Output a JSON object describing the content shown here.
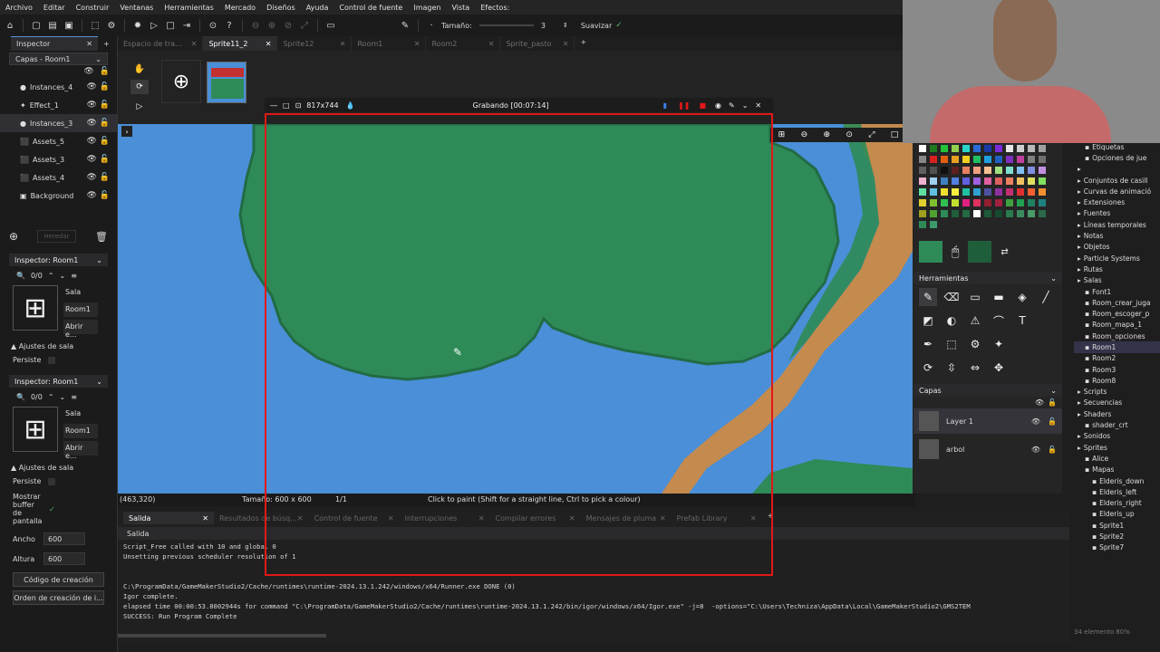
{
  "menubar": [
    "Archivo",
    "Editar",
    "Construir",
    "Ventanas",
    "Herramientas",
    "Mercado",
    "Diseños",
    "Ayuda",
    "Control de fuente",
    "Imagen",
    "Vista",
    "Efectos:"
  ],
  "toolbar": {
    "size_label": "Tamaño:",
    "size_value": "3",
    "smooth_label": "Suavizar"
  },
  "tabs": [
    {
      "label": "Espacio de tra...",
      "active": false
    },
    {
      "label": "Sprite11_2",
      "active": true
    },
    {
      "label": "Sprite12",
      "active": false
    },
    {
      "label": "Room1",
      "active": false
    },
    {
      "label": "Room2",
      "active": false
    },
    {
      "label": "Sprite_pasto",
      "active": false
    }
  ],
  "left": {
    "inspector_tab": "Inspector",
    "layers_select": "Capas - Room1",
    "layers": [
      {
        "name": "Instances_4",
        "icon": "instances-icon",
        "selected": false
      },
      {
        "name": "Effect_1",
        "icon": "effect-icon",
        "selected": false
      },
      {
        "name": "Instances_3",
        "icon": "instances-icon",
        "selected": true
      },
      {
        "name": "Assets_5",
        "icon": "assets-icon",
        "selected": false
      },
      {
        "name": "Assets_3",
        "icon": "assets-icon",
        "selected": false
      },
      {
        "name": "Assets_4",
        "icon": "assets-icon",
        "selected": false
      },
      {
        "name": "Background",
        "icon": "background-icon",
        "selected": false
      }
    ],
    "inherit_label": "Heredar",
    "inspector1": {
      "title": "Inspector: Room1",
      "count": "0/0",
      "sala": "Sala",
      "room": "Room1",
      "open": "Abrir e...",
      "settings": "Ajustes de sala",
      "persist": "Persiste"
    },
    "inspector2": {
      "title": "Inspector: Room1",
      "count": "0/0",
      "sala": "Sala",
      "room": "Room1",
      "open": "Abrir e...",
      "settings": "Ajustes de sala",
      "persist": "Persiste",
      "show_buffer": "Mostrar buffer de pantalla",
      "width_label": "Ancho",
      "width": "600",
      "height_label": "Altura",
      "height": "600",
      "code_btn": "Código de creación",
      "order_btn": "Orden de creación de i..."
    }
  },
  "recorder": {
    "size": "817x744",
    "status": "Grabando [00:07:14]"
  },
  "status": {
    "coords": "(463,320)",
    "size": "Tamaño: 600 x 600",
    "frame": "1/1",
    "hint": "Click to paint (Shift for a straight line, Ctrl to pick a colour)"
  },
  "output": {
    "tabs": [
      "Salida",
      "Resultados de búsq...",
      "Control de fuente",
      "Interrupciones",
      "Compilar errores",
      "Mensajes de pluma",
      "Prefab Library"
    ],
    "header": "Salida",
    "lines": [
      "Script_Free called with 10 and global 0",
      "Unsetting previous scheduler resolution of 1",
      "",
      "",
      "C:\\ProgramData/GameMakerStudio2/Cache/runtimes\\runtime-2024.13.1.242/windows/x64/Runner.exe DONE (0)",
      "Igor complete.",
      "elapsed time 00:00:53.8002944s for command \"C:\\ProgramData/GameMakerStudio2/Cache/runtimes\\runtime-2024.13.1.242/bin/igor/windows/x64/Igor.exe\" -j=8  -options=\"C:\\Users\\Techniza\\AppData\\Local\\GameMakerStudio2\\GMS2TEM",
      "SUCCESS: Run Program Complete"
    ]
  },
  "right": {
    "tools_label": "Herramientas",
    "layers_label": "Capas",
    "layer1": "Layer 1",
    "layer2": "arbol",
    "palette": [
      "#ffffff",
      "#1e7a1e",
      "#22c33a",
      "#8fd14f",
      "#2bd4c9",
      "#2a6cd6",
      "#1a3aa8",
      "#7b2cd6",
      "#e8e8e8",
      "#d0d0d0",
      "#b8b8b8",
      "#a0a0a0",
      "#888888",
      "#d92020",
      "#e06010",
      "#e8a020",
      "#f0d020",
      "#20c060",
      "#20a0e0",
      "#2060c0",
      "#8030c0",
      "#c040a0",
      "#808080",
      "#707070",
      "#606060",
      "#505050",
      "#101010",
      "#602020",
      "#e88060",
      "#f0a080",
      "#f8c090",
      "#a0e080",
      "#80e0d0",
      "#80c0f0",
      "#8090e0",
      "#c090e0",
      "#f0b0d0",
      "#a0d0f0",
      "#4080c0",
      "#5080e0",
      "#6060e0",
      "#a060e0",
      "#e060a0",
      "#e06060",
      "#f08060",
      "#f0c060",
      "#e0e060",
      "#80e060",
      "#60e0a0",
      "#60c0e0",
      "#f0e030",
      "#f8f040",
      "#20c0a0",
      "#30a0d0",
      "#5050a0",
      "#9030a0",
      "#c03070",
      "#e03030",
      "#f06030",
      "#f09030",
      "#e0d030",
      "#80c030",
      "#30c050",
      "#c0e030",
      "#e02080",
      "#e03060",
      "#902030",
      "#a02040",
      "#40a040",
      "#20a050",
      "#208060",
      "#208080",
      "#a0a020",
      "#50a030",
      "#2e8b57",
      "#1f5e3a",
      "#226b44",
      "#ffffff",
      "#1a5a38",
      "#164a2e",
      "#2a7a4e",
      "#3a8a5e",
      "#4a9a6a",
      "#2a6a4a",
      "#2e8b57",
      "#3a9a6a"
    ],
    "primary_color": "#2e8b57",
    "secondary_color": "#1f5e3a"
  },
  "tree": [
    {
      "label": "Etiquetas",
      "indent": 1
    },
    {
      "label": "Opciones de jue",
      "indent": 1
    },
    {
      "label": "",
      "indent": 0
    },
    {
      "label": "Conjuntos de casill",
      "indent": 0
    },
    {
      "label": "Curvas de animació",
      "indent": 0
    },
    {
      "label": "Extensiones",
      "indent": 0
    },
    {
      "label": "Fuentes",
      "indent": 0
    },
    {
      "label": "Líneas temporales",
      "indent": 0
    },
    {
      "label": "Notas",
      "indent": 0
    },
    {
      "label": "Objetos",
      "indent": 0
    },
    {
      "label": "Particle Systems",
      "indent": 0
    },
    {
      "label": "Rutas",
      "indent": 0
    },
    {
      "label": "Salas",
      "indent": 0
    },
    {
      "label": "Font1",
      "indent": 1
    },
    {
      "label": "Room_crear_juga",
      "indent": 1
    },
    {
      "label": "Room_escoger_p",
      "indent": 1
    },
    {
      "label": "Room_mapa_1",
      "indent": 1
    },
    {
      "label": "Room_opciones",
      "indent": 1
    },
    {
      "label": "Room1",
      "indent": 1,
      "selected": true
    },
    {
      "label": "Room2",
      "indent": 1
    },
    {
      "label": "Room3",
      "indent": 1
    },
    {
      "label": "Room8",
      "indent": 1
    },
    {
      "label": "Scripts",
      "indent": 0
    },
    {
      "label": "Secuencias",
      "indent": 0
    },
    {
      "label": "Shaders",
      "indent": 0
    },
    {
      "label": "shader_crt",
      "indent": 1
    },
    {
      "label": "Sonidos",
      "indent": 0
    },
    {
      "label": "Sprites",
      "indent": 0
    },
    {
      "label": "Alice",
      "indent": 1
    },
    {
      "label": "Mapas",
      "indent": 1
    },
    {
      "label": "Elderis_down",
      "indent": 2
    },
    {
      "label": "Elderis_left",
      "indent": 2
    },
    {
      "label": "Elderis_right",
      "indent": 2
    },
    {
      "label": "Elderis_up",
      "indent": 2
    },
    {
      "label": "Sprite1",
      "indent": 2
    },
    {
      "label": "Sprite2",
      "indent": 2
    },
    {
      "label": "Sprite7",
      "indent": 2
    }
  ],
  "footer": {
    "count": "34 elemento",
    "zoom": "80%"
  }
}
